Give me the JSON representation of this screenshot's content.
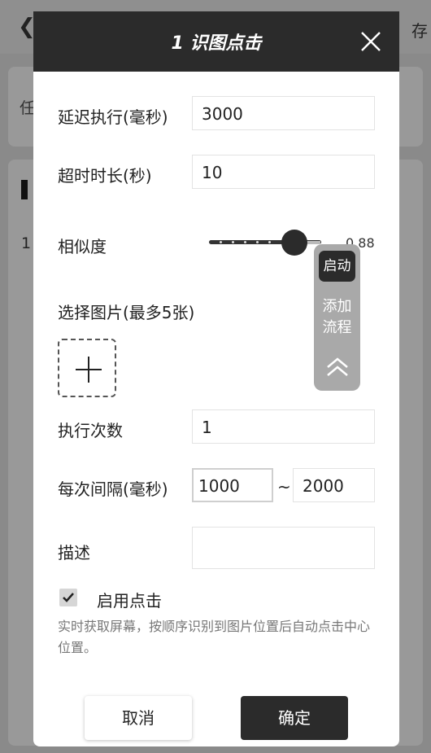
{
  "background": {
    "back_icon": "chevron-left-icon",
    "save_label": "存",
    "left_label": "任",
    "row_number": "1"
  },
  "dialog": {
    "title": "1 识图点击",
    "close_icon": "close-icon",
    "fields": {
      "delay_label": "延迟执行(毫秒)",
      "delay_value": "3000",
      "timeout_label": "超时时长(秒)",
      "timeout_value": "10",
      "similarity_label": "相似度",
      "similarity_value": "0.88",
      "similarity_fraction": 0.88,
      "select_image_label": "选择图片(最多5张)",
      "add_image_icon": "plus-icon",
      "exec_count_label": "执行次数",
      "exec_count_value": "1",
      "interval_label": "每次间隔(毫秒)",
      "interval_min": "1000",
      "interval_separator": "~",
      "interval_max": "2000",
      "description_label": "描述",
      "description_value": ""
    },
    "enable_click": {
      "checked": true,
      "label": "启用点击",
      "description": "实时获取屏幕，按顺序识别到图片位置后自动点击中心位置。"
    },
    "buttons": {
      "cancel": "取消",
      "confirm": "确定"
    }
  },
  "floating_panel": {
    "start_label": "启动",
    "add_flow_label_line1": "添加",
    "add_flow_label_line2": "流程",
    "collapse_icon": "double-chevron-up-icon"
  },
  "colors": {
    "header_bg": "#2b2b2b",
    "overlay_bg": "#8a8a8a",
    "primary_button": "#2b2b2b"
  }
}
